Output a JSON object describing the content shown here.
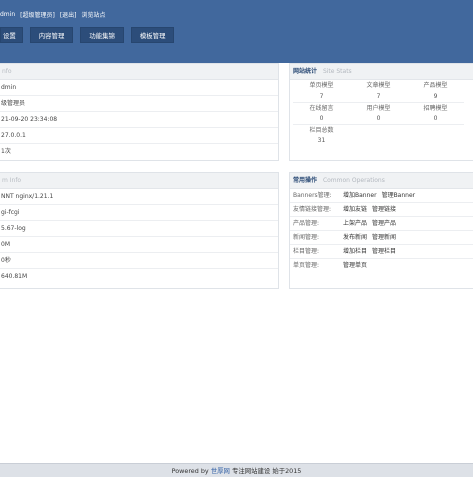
{
  "header": {
    "user_links": [
      "dmin",
      "[超级管理员]",
      "[退出]",
      "浏览站点"
    ]
  },
  "nav": {
    "items": [
      "设置",
      "内容管理",
      "功能集锦",
      "模板管理"
    ]
  },
  "site_info": {
    "title": "",
    "subtitle": "nfo",
    "rows": [
      "dmin",
      "级管理员",
      "21-09-20 23:34:08",
      "27.0.0.1",
      "1次"
    ]
  },
  "site_stats": {
    "title": "网站统计",
    "subtitle": "Site Stats",
    "labels_row1": [
      "单页模型",
      "文章模型",
      "产品模型"
    ],
    "values_row1": [
      "7",
      "7",
      "9"
    ],
    "labels_row2": [
      "在线留言",
      "用户模型",
      "招聘模型"
    ],
    "values_row2": [
      "0",
      "0",
      "0"
    ],
    "labels_row3": [
      "栏目总数"
    ],
    "values_row3": [
      "31"
    ]
  },
  "system_info": {
    "title": "",
    "subtitle": "m Info",
    "rows": [
      "NNT nginx/1.21.1",
      "gi-fcgi",
      "5.67-log",
      "0M",
      "0秒",
      "640.81M"
    ]
  },
  "operations": {
    "title": "常用操作",
    "subtitle": "Common Operations",
    "rows": [
      {
        "label": "Banners管理:",
        "links": [
          "增加Banner",
          "管理Banner"
        ]
      },
      {
        "label": "友情链接管理:",
        "links": [
          "增加友链",
          "管理链接"
        ]
      },
      {
        "label": "产品管理:",
        "links": [
          "上架产品",
          "管理产品"
        ]
      },
      {
        "label": "新闻管理:",
        "links": [
          "发布新闻",
          "管理新闻"
        ]
      },
      {
        "label": "栏目管理:",
        "links": [
          "增加栏目",
          "管理栏目"
        ]
      },
      {
        "label": "单页管理:",
        "links": [
          "管理单页"
        ]
      }
    ]
  },
  "footer": {
    "prefix": "Powered by",
    "brand": "世厚网",
    "slogan": "专注网站建设",
    "since": "始于2015"
  }
}
